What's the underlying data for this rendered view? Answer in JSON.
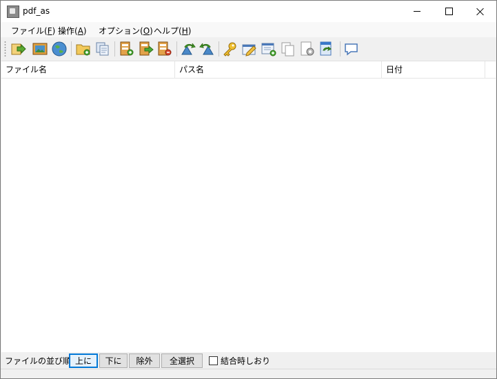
{
  "window": {
    "title": "pdf_as"
  },
  "menu": [
    {
      "label": "ファイル(",
      "key": "F",
      "suffix": ")"
    },
    {
      "label": "操作(",
      "key": "A",
      "suffix": ")"
    },
    {
      "label": "オプション(",
      "key": "O",
      "suffix": ")"
    },
    {
      "label": "ヘルプ(",
      "key": "H",
      "suffix": ")"
    }
  ],
  "toolbar": {
    "icons": [
      "open-file-icon",
      "image-icon",
      "globe-icon",
      "folder-add-icon",
      "copy-pages-icon",
      "add-file-icon",
      "export-file-icon",
      "remove-file-icon",
      "rotate-left-icon",
      "rotate-right-icon",
      "key-icon",
      "edit-icon",
      "window-add-icon",
      "blank-page-icon",
      "page-settings-icon",
      "refresh-icon",
      "comment-icon"
    ]
  },
  "list": {
    "columns": [
      "ファイル名",
      "パス名",
      "日付"
    ],
    "rows": []
  },
  "bottom": {
    "order_label": "ファイルの並び順:",
    "up_button": "上に",
    "down_button": "下に",
    "remove_button": "除外",
    "select_all_button": "全選択",
    "bookmark_checkbox_label": "結合時しおり",
    "bookmark_checked": false
  },
  "colors": {
    "accent": "#0078d7"
  }
}
